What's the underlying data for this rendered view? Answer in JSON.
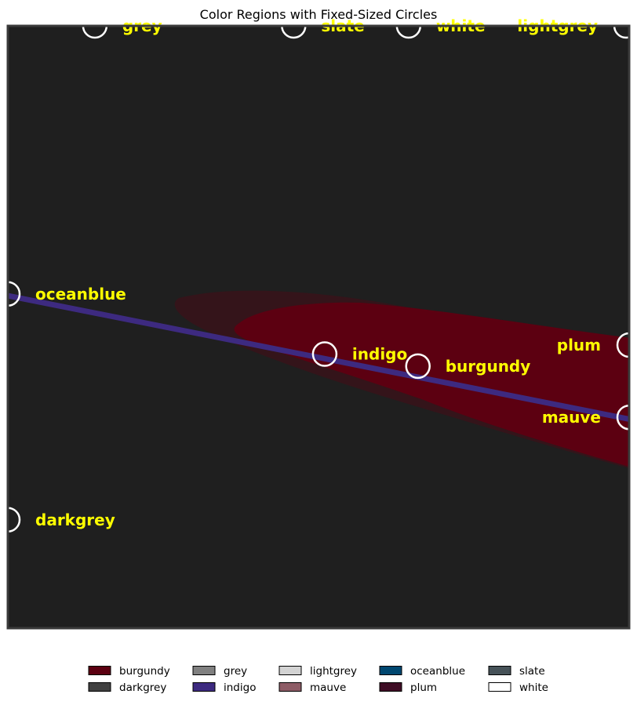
{
  "chart_data": {
    "type": "region_map",
    "title": "Color Regions with Fixed-Sized Circles",
    "background_color": "#1f1f1f",
    "xlim": [
      0,
      100
    ],
    "ylim": [
      0,
      100
    ],
    "regions": [
      {
        "name": "burgundy",
        "color": "#5c0011"
      },
      {
        "name": "indigo",
        "color": "#3d2a80"
      }
    ],
    "circles": [
      {
        "label": "grey",
        "x": 14,
        "y": 100
      },
      {
        "label": "slate",
        "x": 46,
        "y": 100
      },
      {
        "label": "white",
        "x": 64.5,
        "y": 100
      },
      {
        "label": "lightgrey",
        "x": 99.5,
        "y": 100
      },
      {
        "label": "oceanblue",
        "x": 0,
        "y": 55.5
      },
      {
        "label": "indigo",
        "x": 51,
        "y": 45.5
      },
      {
        "label": "burgundy",
        "x": 66,
        "y": 43.5
      },
      {
        "label": "plum",
        "x": 100,
        "y": 47
      },
      {
        "label": "mauve",
        "x": 100,
        "y": 35
      },
      {
        "label": "darkgrey",
        "x": 0,
        "y": 18
      }
    ],
    "legend": [
      {
        "label": "burgundy",
        "color": "#5c0011"
      },
      {
        "label": "darkgrey",
        "color": "#404040"
      },
      {
        "label": "grey",
        "color": "#808080"
      },
      {
        "label": "indigo",
        "color": "#3d2a80"
      },
      {
        "label": "lightgrey",
        "color": "#d3d3d3"
      },
      {
        "label": "mauve",
        "color": "#8e5c66"
      },
      {
        "label": "oceanblue",
        "color": "#004770"
      },
      {
        "label": "plum",
        "color": "#3f0d25"
      },
      {
        "label": "slate",
        "color": "#465258"
      },
      {
        "label": "white",
        "color": "#ffffff"
      }
    ],
    "legend_position": "bottom",
    "circle_style": {
      "stroke": "#ffffff",
      "fill": "none"
    },
    "label_color": "#ffff00"
  }
}
